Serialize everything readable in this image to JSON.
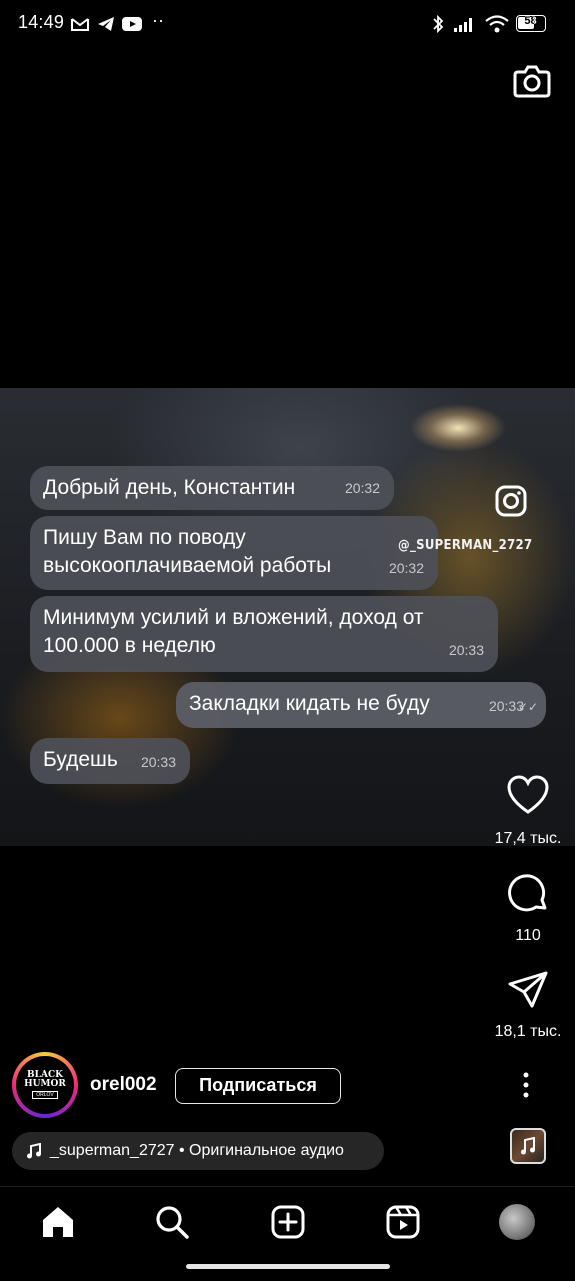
{
  "status_bar": {
    "time": "14:49",
    "battery": "58",
    "icons": [
      "gmail-icon",
      "telegram-icon",
      "youtube-icon",
      "more-dots-icon",
      "bluetooth-icon",
      "signal-icon",
      "wifi-icon",
      "battery-icon"
    ]
  },
  "header": {
    "camera_icon": "camera-icon"
  },
  "video": {
    "messages": [
      {
        "text": "Добрый день, Константин",
        "time": "20:32",
        "direction": "incoming"
      },
      {
        "text": "Пишу Вам по поводу высокооплачиваемой работы",
        "line1": "Пишу Вам по поводу",
        "line2": "высокооплачиваемой работы",
        "time": "20:32",
        "direction": "incoming"
      },
      {
        "line1": "Минимум усилий и вложений, доход от",
        "line2": "100.000 в неделю",
        "time": "20:33",
        "direction": "incoming"
      },
      {
        "text": "Закладки кидать не буду",
        "time": "20:33",
        "direction": "outgoing"
      },
      {
        "text": "Будешь",
        "time": "20:33",
        "direction": "incoming"
      }
    ],
    "watermark": "@_SUPERMAN_2727",
    "watermark_icon": "instagram-icon"
  },
  "actions": {
    "likes": "17,4 тыс.",
    "comments": "110",
    "shares": "18,1 тыс."
  },
  "author": {
    "avatar_line1": "BLACK",
    "avatar_line2": "HUMOR",
    "avatar_line3": "ORLOV",
    "username": "orel002",
    "follow_label": "Подписаться"
  },
  "audio": {
    "label": "_superman_2727 • Оригинальное аудио"
  },
  "bottom_nav": {
    "items": [
      "home-icon",
      "search-icon",
      "create-icon",
      "reels-icon",
      "profile-avatar"
    ]
  },
  "colors": {
    "background": "#000000",
    "bubble": "#4e5058",
    "pill": "#262626"
  }
}
